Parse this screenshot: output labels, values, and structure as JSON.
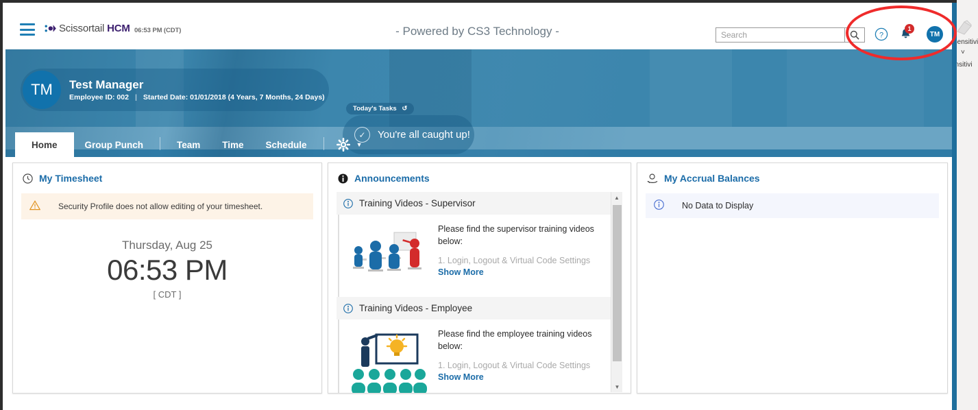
{
  "background_window": {
    "icon": "sensitivity-label-icon",
    "label_1": "Sensitivi",
    "chevron": "˅",
    "label_2": "ensitivi"
  },
  "topbar": {
    "menu_icon": "hamburger-menu-icon",
    "brand_name": "Scissortail ",
    "brand_bold": "HCM",
    "brand_mark": "scissortail-logo-icon",
    "clock": "06:53 PM (CDT)",
    "powered_by": "- Powered by CS3 Technology -",
    "search_placeholder": "Search",
    "search_value": "",
    "search_icon": "search-icon",
    "help_icon": "help-circle-icon",
    "bell_icon": "notification-bell-icon",
    "bell_count": "1",
    "avatar_initials": "TM"
  },
  "hero": {
    "avatar_initials": "TM",
    "employee_name": "Test Manager",
    "employee_id": "Employee ID: 002",
    "separator": "|",
    "started_date": "Started Date: 01/01/2018 (4 Years, 7 Months, 24 Days)",
    "tasks_tag": "Today's Tasks",
    "tasks_refresh_icon": "refresh-icon",
    "tasks_check_icon": "check-circle-icon",
    "tasks_message": "You're all caught up!"
  },
  "nav": {
    "tabs": [
      {
        "label": "Home",
        "active": true
      },
      {
        "label": "Group Punch",
        "active": false
      },
      {
        "label": "Team",
        "active": false
      },
      {
        "label": "Time",
        "active": false
      },
      {
        "label": "Schedule",
        "active": false
      }
    ],
    "gear_icon": "gear-icon",
    "gear_caret": "caret-down-icon"
  },
  "timesheet_card": {
    "icon": "clock-icon",
    "title": "My Timesheet",
    "warning_icon": "warning-triangle-icon",
    "warning_text": "Security Profile does not allow editing of your timesheet.",
    "day": "Thursday, Aug 25",
    "time": "06:53 PM",
    "timezone": "[ CDT ]"
  },
  "announcements_card": {
    "icon": "info-bold-icon",
    "title": "Announcements",
    "scroll_up_icon": "scroll-up-arrow",
    "scroll_down_icon": "scroll-down-arrow",
    "items": [
      {
        "icon": "info-circle-icon",
        "title": "Training Videos - Supervisor",
        "thumb": "classroom-training-image",
        "lead": "Please find the supervisor training videos below:",
        "faded": "1. Login, Logout & Virtual Code Settings",
        "show_more": "Show More"
      },
      {
        "icon": "info-circle-icon",
        "title": "Training Videos - Employee",
        "thumb": "presenter-lightbulb-image",
        "lead": "Please find the employee training videos below:",
        "faded": "1. Login, Logout & Virtual Code Settings",
        "show_more": "Show More"
      }
    ]
  },
  "accruals_card": {
    "icon": "accrual-hand-icon",
    "title": "My Accrual Balances",
    "empty_icon": "info-circle-icon",
    "empty_text": "No Data to Display"
  },
  "annotation": {
    "shape": "red-ellipse-highlight",
    "color": "#ef2b2b"
  }
}
